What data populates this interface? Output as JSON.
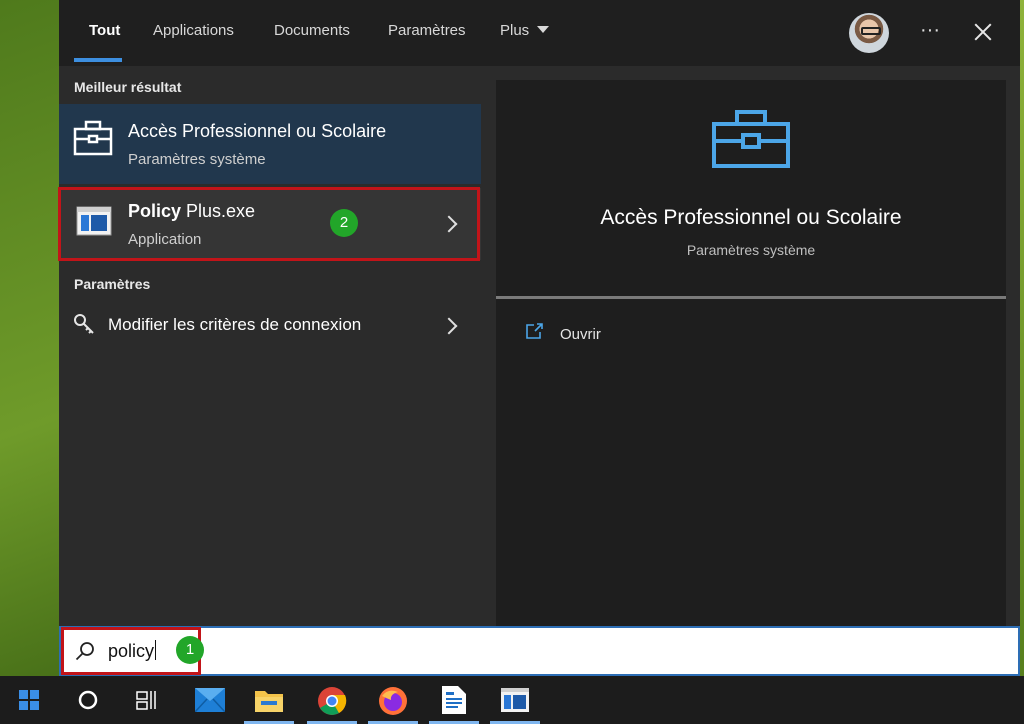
{
  "tabs": [
    {
      "label": "Tout",
      "active": true
    },
    {
      "label": "Applications"
    },
    {
      "label": "Documents"
    },
    {
      "label": "Paramètres"
    },
    {
      "label": "Plus"
    }
  ],
  "header": {
    "more_label": "···"
  },
  "sections": {
    "best_result": "Meilleur résultat",
    "settings": "Paramètres"
  },
  "results": {
    "best": {
      "title": "Accès Professionnel ou Scolaire",
      "subtitle": "Paramètres système",
      "icon": "briefcase-icon"
    },
    "policy": {
      "title_bold": "Policy",
      "title_rest": " Plus.exe",
      "subtitle": "Application",
      "icon": "app-window-icon"
    },
    "setting": {
      "title": "Modifier les critères de connexion",
      "icon": "key-icon"
    }
  },
  "badges": {
    "one": "1",
    "two": "2"
  },
  "preview": {
    "title": "Accès Professionnel ou Scolaire",
    "subtitle": "Paramètres système",
    "open_label": "Ouvrir",
    "icon": "briefcase-icon"
  },
  "search": {
    "value": "policy",
    "icon": "search-icon"
  },
  "taskbar": [
    {
      "name": "windows-start-icon"
    },
    {
      "name": "cortana-icon"
    },
    {
      "name": "task-view-icon"
    },
    {
      "name": "mail-icon"
    },
    {
      "name": "file-explorer-icon"
    },
    {
      "name": "chrome-icon"
    },
    {
      "name": "firefox-icon"
    },
    {
      "name": "document-icon"
    },
    {
      "name": "policy-plus-icon"
    }
  ],
  "colors": {
    "accent": "#3d8fe0",
    "highlight": "#c21419",
    "badge": "#22a629",
    "selected_bg": "#21374d"
  }
}
